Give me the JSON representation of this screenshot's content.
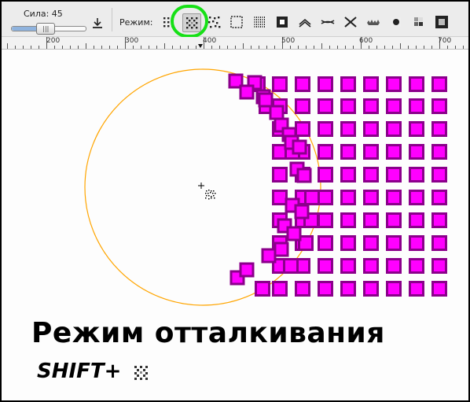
{
  "toolbar": {
    "strength_label": "Сила: 45",
    "strength_value": 45,
    "strength_max": 100,
    "mode_label": "Режим:",
    "modes": [
      {
        "icon": "move-mode-icon",
        "active": false
      },
      {
        "icon": "repel-mode-icon",
        "active": true
      },
      {
        "icon": "random-move-icon",
        "active": false
      },
      {
        "icon": "scale-mode-icon",
        "active": false
      },
      {
        "icon": "rotate-mode-icon",
        "active": false
      },
      {
        "icon": "duplicate-mode-icon",
        "active": false
      },
      {
        "icon": "push-path-icon",
        "active": false
      },
      {
        "icon": "shrink-path-icon",
        "active": false
      },
      {
        "icon": "attract-path-icon",
        "active": false
      },
      {
        "icon": "roughen-icon",
        "active": false
      },
      {
        "icon": "paint-icon",
        "active": false
      },
      {
        "icon": "jitter-color-icon",
        "active": false
      },
      {
        "icon": "blur-icon",
        "active": false
      }
    ]
  },
  "ruler": {
    "labels": [
      "200",
      "300",
      "400",
      "500",
      "600",
      "700"
    ]
  },
  "caption": {
    "title": "Режим отталкивания",
    "shortcut": "SHIFT+"
  },
  "colors": {
    "square_fill": "#ff00ff",
    "square_stroke": "#8b008b",
    "circle": "#ffa500",
    "highlight": "#16e016"
  }
}
